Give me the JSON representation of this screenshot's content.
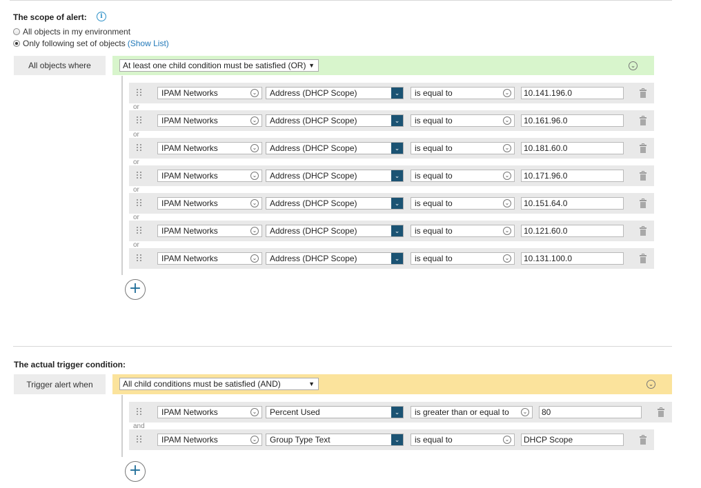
{
  "scope": {
    "title": "The scope of alert:",
    "info_icon": "info-icon",
    "options": [
      {
        "label": "All objects in my environment",
        "checked": false
      },
      {
        "label": "Only following set of objects",
        "checked": true
      }
    ],
    "show_list_link": "(Show List)",
    "group_label": "All objects where",
    "group_mode": "At least one child condition must be satisfied (OR)",
    "conjunction": "or",
    "conditions": [
      {
        "entity": "IPAM Networks",
        "field": "Address (DHCP Scope)",
        "operator": "is equal to",
        "value": "10.141.196.0"
      },
      {
        "entity": "IPAM Networks",
        "field": "Address (DHCP Scope)",
        "operator": "is equal to",
        "value": "10.161.96.0"
      },
      {
        "entity": "IPAM Networks",
        "field": "Address (DHCP Scope)",
        "operator": "is equal to",
        "value": "10.181.60.0"
      },
      {
        "entity": "IPAM Networks",
        "field": "Address (DHCP Scope)",
        "operator": "is equal to",
        "value": "10.171.96.0"
      },
      {
        "entity": "IPAM Networks",
        "field": "Address (DHCP Scope)",
        "operator": "is equal to",
        "value": "10.151.64.0"
      },
      {
        "entity": "IPAM Networks",
        "field": "Address (DHCP Scope)",
        "operator": "is equal to",
        "value": "10.121.60.0"
      },
      {
        "entity": "IPAM Networks",
        "field": "Address (DHCP Scope)",
        "operator": "is equal to",
        "value": "10.131.100.0"
      }
    ]
  },
  "trigger": {
    "title": "The actual trigger condition:",
    "group_label": "Trigger alert when",
    "group_mode": "All child conditions must be satisfied (AND)",
    "conjunction": "and",
    "conditions": [
      {
        "entity": "IPAM Networks",
        "field": "Percent Used",
        "operator": "is greater than or equal to",
        "value": "80"
      },
      {
        "entity": "IPAM Networks",
        "field": "Group Type Text",
        "operator": "is equal to",
        "value": "DHCP Scope"
      }
    ]
  },
  "colors": {
    "or_group_bar": "#d8f5cc",
    "and_group_bar": "#fbe39c",
    "dropdown_button": "#1b5373",
    "link": "#1f77b8"
  },
  "icons": {
    "drag": "drag-handle-icon",
    "dropdown": "chevron-down-circle-icon",
    "collapse": "collapse-circle-icon",
    "delete": "trash-icon",
    "add": "add-circle-icon"
  }
}
